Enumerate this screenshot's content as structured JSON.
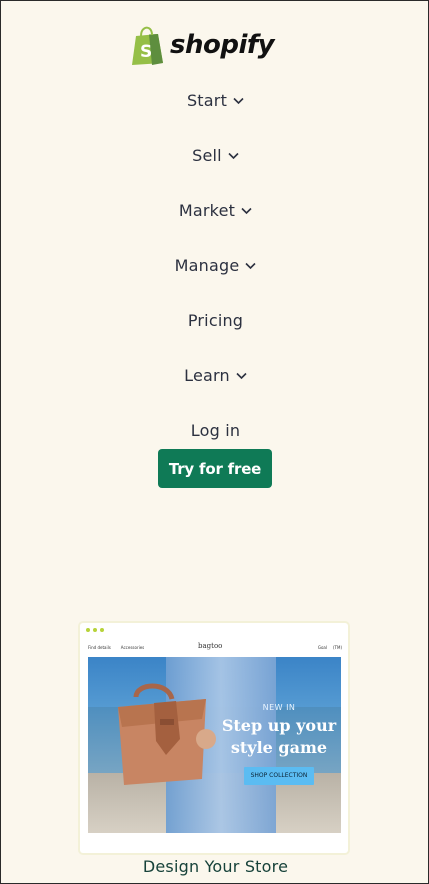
{
  "brand": {
    "name": "shopify",
    "logo_icon": "shopping-bag-icon",
    "logo_color": "#95bf47"
  },
  "nav": {
    "items": [
      {
        "label": "Start",
        "has_dropdown": true
      },
      {
        "label": "Sell",
        "has_dropdown": true
      },
      {
        "label": "Market",
        "has_dropdown": true
      },
      {
        "label": "Manage",
        "has_dropdown": true
      },
      {
        "label": "Pricing",
        "has_dropdown": false
      },
      {
        "label": "Learn",
        "has_dropdown": true
      },
      {
        "label": "Log in",
        "has_dropdown": false
      }
    ]
  },
  "cta": {
    "label": "Try for free",
    "color": "#0f7a56"
  },
  "preview": {
    "store_brand": "bagtoo",
    "top_left_links": [
      "Find details",
      "Accessories"
    ],
    "top_right_links": [
      "Goal",
      "(TM)"
    ],
    "hero": {
      "eyebrow": "NEW IN",
      "headline_line1": "Step up your",
      "headline_line2": "style game",
      "button": "SHOP COLLECTION"
    }
  },
  "caption": "Design Your Store",
  "colors": {
    "background": "#fbf7ed",
    "text": "#1f2533"
  }
}
